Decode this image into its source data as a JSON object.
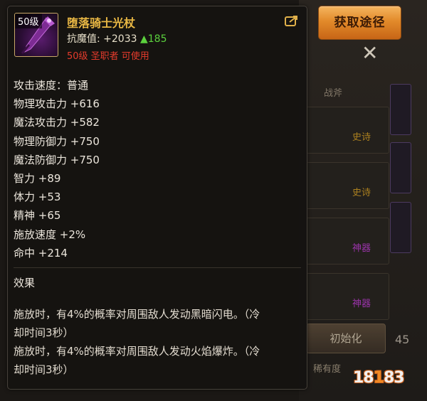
{
  "background": {
    "tab": "战斧",
    "tags": [
      {
        "text": "史诗",
        "color": "#d9a020"
      },
      {
        "text": "史诗",
        "color": "#d9a020"
      },
      {
        "text": "神器",
        "color": "#c23bd9"
      },
      {
        "text": "神器",
        "color": "#c23bd9"
      }
    ],
    "init_button": "初始化",
    "bottom_text": "稀有度",
    "side_number": "45"
  },
  "source_button": "获取途径",
  "item": {
    "level_badge": "50级",
    "name": "堕落骑士光杖",
    "resist_label": "抗魔值:",
    "resist_value": "+2033",
    "resist_delta": "▲185",
    "requirement": "50级 圣职者 可使用",
    "stats": [
      "攻击速度：普通",
      "物理攻击力 +616",
      "魔法攻击力 +582",
      "物理防御力 +750",
      "魔法防御力 +750",
      "智力 +89",
      "体力 +53",
      "精神 +65",
      "施放速度 +2%",
      "命中 +214"
    ],
    "effect_title": "效果",
    "effect_lines": [
      "施放时，有4%的概率对周围敌人发动黑暗闪电。（冷",
      "却时间3秒）",
      "施放时，有4%的概率对周围敌人发动火焰爆炸。（冷",
      "却时间3秒）"
    ]
  },
  "watermark": {
    "prefix": "18",
    "mid": "1",
    "suffix": "83"
  },
  "colors": {
    "item_name": "#e8b744",
    "requirement": "#e53b2c",
    "resist_up": "#5bd13d",
    "button": "#e28a2a"
  },
  "icons": [
    "share-icon",
    "staff-item-icon"
  ]
}
